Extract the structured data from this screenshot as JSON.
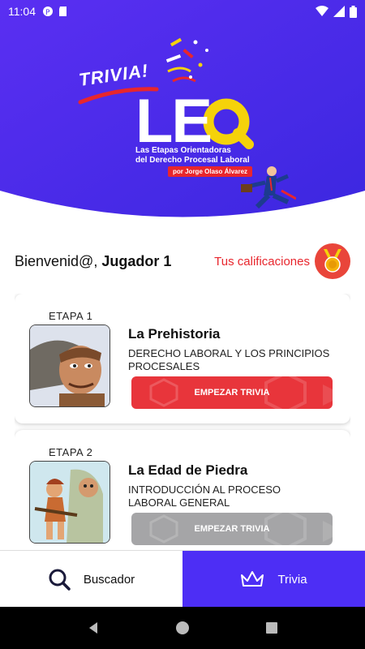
{
  "status_bar": {
    "time": "11:04"
  },
  "header": {
    "trivia_badge": "TRIVIA!",
    "logo_letters": "LE",
    "subtitle_line1": "Las Etapas Orientadoras",
    "subtitle_line2": "del Derecho Procesal Laboral",
    "author": "por Jorge Olaso Álvarez"
  },
  "welcome": {
    "greeting": "Bienvenid@,",
    "player": "Jugador 1",
    "grades_link": "Tus calificaciones"
  },
  "cards": [
    {
      "stage": "ETAPA 1",
      "title": "La Prehistoria",
      "description": "DERECHO LABORAL Y LOS PRINCIPIOS PROCESALES",
      "button": "EMPEZAR TRIVIA",
      "button_color": "#e8353b"
    },
    {
      "stage": "ETAPA 2",
      "title": "La Edad de Piedra",
      "description": "INTRODUCCIÓN AL PROCESO LABORAL GENERAL",
      "button": "EMPEZAR TRIVIA",
      "button_color": "#a5a5a7"
    }
  ],
  "bottom_nav": {
    "search_label": "Buscador",
    "search_icon": "search-icon",
    "trivia_label": "Trivia",
    "trivia_icon": "crown-icon",
    "active_color": "#4d2ef5"
  },
  "colors": {
    "brand_purple": "#4d2ef5",
    "accent_red": "#e8353b",
    "accent_yellow": "#f5d20a"
  }
}
